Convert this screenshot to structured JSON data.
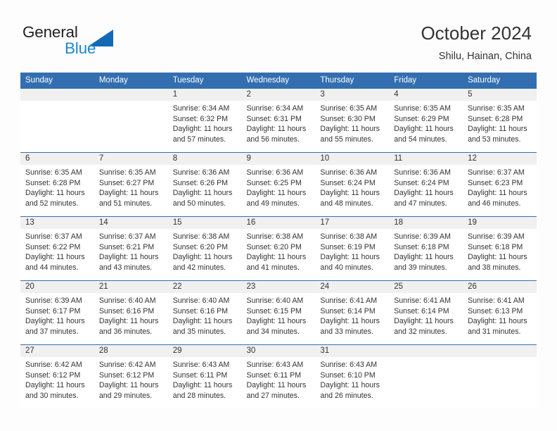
{
  "brand": {
    "name_part1": "General",
    "name_part2": "Blue",
    "triangle_color": "#1469b7",
    "blue_text_color": "#1b87d4"
  },
  "header": {
    "title": "October 2024",
    "location": "Shilu, Hainan, China"
  },
  "theme": {
    "header_row_bg": "#336fb0",
    "daynum_band_bg": "#f0f0f0",
    "row_separator": "#336fb0",
    "text_color": "#333333"
  },
  "weekdays": [
    "Sunday",
    "Monday",
    "Tuesday",
    "Wednesday",
    "Thursday",
    "Friday",
    "Saturday"
  ],
  "labels": {
    "sunrise_prefix": "Sunrise: ",
    "sunset_prefix": "Sunset: ",
    "daylight_prefix": "Daylight: "
  },
  "weeks": [
    [
      {
        "empty": true
      },
      {
        "empty": true
      },
      {
        "day": "1",
        "sunrise": "Sunrise: 6:34 AM",
        "sunset": "Sunset: 6:32 PM",
        "daylight_l1": "Daylight: 11 hours",
        "daylight_l2": "and 57 minutes."
      },
      {
        "day": "2",
        "sunrise": "Sunrise: 6:34 AM",
        "sunset": "Sunset: 6:31 PM",
        "daylight_l1": "Daylight: 11 hours",
        "daylight_l2": "and 56 minutes."
      },
      {
        "day": "3",
        "sunrise": "Sunrise: 6:35 AM",
        "sunset": "Sunset: 6:30 PM",
        "daylight_l1": "Daylight: 11 hours",
        "daylight_l2": "and 55 minutes."
      },
      {
        "day": "4",
        "sunrise": "Sunrise: 6:35 AM",
        "sunset": "Sunset: 6:29 PM",
        "daylight_l1": "Daylight: 11 hours",
        "daylight_l2": "and 54 minutes."
      },
      {
        "day": "5",
        "sunrise": "Sunrise: 6:35 AM",
        "sunset": "Sunset: 6:28 PM",
        "daylight_l1": "Daylight: 11 hours",
        "daylight_l2": "and 53 minutes."
      }
    ],
    [
      {
        "day": "6",
        "sunrise": "Sunrise: 6:35 AM",
        "sunset": "Sunset: 6:28 PM",
        "daylight_l1": "Daylight: 11 hours",
        "daylight_l2": "and 52 minutes."
      },
      {
        "day": "7",
        "sunrise": "Sunrise: 6:35 AM",
        "sunset": "Sunset: 6:27 PM",
        "daylight_l1": "Daylight: 11 hours",
        "daylight_l2": "and 51 minutes."
      },
      {
        "day": "8",
        "sunrise": "Sunrise: 6:36 AM",
        "sunset": "Sunset: 6:26 PM",
        "daylight_l1": "Daylight: 11 hours",
        "daylight_l2": "and 50 minutes."
      },
      {
        "day": "9",
        "sunrise": "Sunrise: 6:36 AM",
        "sunset": "Sunset: 6:25 PM",
        "daylight_l1": "Daylight: 11 hours",
        "daylight_l2": "and 49 minutes."
      },
      {
        "day": "10",
        "sunrise": "Sunrise: 6:36 AM",
        "sunset": "Sunset: 6:24 PM",
        "daylight_l1": "Daylight: 11 hours",
        "daylight_l2": "and 48 minutes."
      },
      {
        "day": "11",
        "sunrise": "Sunrise: 6:36 AM",
        "sunset": "Sunset: 6:24 PM",
        "daylight_l1": "Daylight: 11 hours",
        "daylight_l2": "and 47 minutes."
      },
      {
        "day": "12",
        "sunrise": "Sunrise: 6:37 AM",
        "sunset": "Sunset: 6:23 PM",
        "daylight_l1": "Daylight: 11 hours",
        "daylight_l2": "and 46 minutes."
      }
    ],
    [
      {
        "day": "13",
        "sunrise": "Sunrise: 6:37 AM",
        "sunset": "Sunset: 6:22 PM",
        "daylight_l1": "Daylight: 11 hours",
        "daylight_l2": "and 44 minutes."
      },
      {
        "day": "14",
        "sunrise": "Sunrise: 6:37 AM",
        "sunset": "Sunset: 6:21 PM",
        "daylight_l1": "Daylight: 11 hours",
        "daylight_l2": "and 43 minutes."
      },
      {
        "day": "15",
        "sunrise": "Sunrise: 6:38 AM",
        "sunset": "Sunset: 6:20 PM",
        "daylight_l1": "Daylight: 11 hours",
        "daylight_l2": "and 42 minutes."
      },
      {
        "day": "16",
        "sunrise": "Sunrise: 6:38 AM",
        "sunset": "Sunset: 6:20 PM",
        "daylight_l1": "Daylight: 11 hours",
        "daylight_l2": "and 41 minutes."
      },
      {
        "day": "17",
        "sunrise": "Sunrise: 6:38 AM",
        "sunset": "Sunset: 6:19 PM",
        "daylight_l1": "Daylight: 11 hours",
        "daylight_l2": "and 40 minutes."
      },
      {
        "day": "18",
        "sunrise": "Sunrise: 6:39 AM",
        "sunset": "Sunset: 6:18 PM",
        "daylight_l1": "Daylight: 11 hours",
        "daylight_l2": "and 39 minutes."
      },
      {
        "day": "19",
        "sunrise": "Sunrise: 6:39 AM",
        "sunset": "Sunset: 6:18 PM",
        "daylight_l1": "Daylight: 11 hours",
        "daylight_l2": "and 38 minutes."
      }
    ],
    [
      {
        "day": "20",
        "sunrise": "Sunrise: 6:39 AM",
        "sunset": "Sunset: 6:17 PM",
        "daylight_l1": "Daylight: 11 hours",
        "daylight_l2": "and 37 minutes."
      },
      {
        "day": "21",
        "sunrise": "Sunrise: 6:40 AM",
        "sunset": "Sunset: 6:16 PM",
        "daylight_l1": "Daylight: 11 hours",
        "daylight_l2": "and 36 minutes."
      },
      {
        "day": "22",
        "sunrise": "Sunrise: 6:40 AM",
        "sunset": "Sunset: 6:16 PM",
        "daylight_l1": "Daylight: 11 hours",
        "daylight_l2": "and 35 minutes."
      },
      {
        "day": "23",
        "sunrise": "Sunrise: 6:40 AM",
        "sunset": "Sunset: 6:15 PM",
        "daylight_l1": "Daylight: 11 hours",
        "daylight_l2": "and 34 minutes."
      },
      {
        "day": "24",
        "sunrise": "Sunrise: 6:41 AM",
        "sunset": "Sunset: 6:14 PM",
        "daylight_l1": "Daylight: 11 hours",
        "daylight_l2": "and 33 minutes."
      },
      {
        "day": "25",
        "sunrise": "Sunrise: 6:41 AM",
        "sunset": "Sunset: 6:14 PM",
        "daylight_l1": "Daylight: 11 hours",
        "daylight_l2": "and 32 minutes."
      },
      {
        "day": "26",
        "sunrise": "Sunrise: 6:41 AM",
        "sunset": "Sunset: 6:13 PM",
        "daylight_l1": "Daylight: 11 hours",
        "daylight_l2": "and 31 minutes."
      }
    ],
    [
      {
        "day": "27",
        "sunrise": "Sunrise: 6:42 AM",
        "sunset": "Sunset: 6:12 PM",
        "daylight_l1": "Daylight: 11 hours",
        "daylight_l2": "and 30 minutes."
      },
      {
        "day": "28",
        "sunrise": "Sunrise: 6:42 AM",
        "sunset": "Sunset: 6:12 PM",
        "daylight_l1": "Daylight: 11 hours",
        "daylight_l2": "and 29 minutes."
      },
      {
        "day": "29",
        "sunrise": "Sunrise: 6:43 AM",
        "sunset": "Sunset: 6:11 PM",
        "daylight_l1": "Daylight: 11 hours",
        "daylight_l2": "and 28 minutes."
      },
      {
        "day": "30",
        "sunrise": "Sunrise: 6:43 AM",
        "sunset": "Sunset: 6:11 PM",
        "daylight_l1": "Daylight: 11 hours",
        "daylight_l2": "and 27 minutes."
      },
      {
        "day": "31",
        "sunrise": "Sunrise: 6:43 AM",
        "sunset": "Sunset: 6:10 PM",
        "daylight_l1": "Daylight: 11 hours",
        "daylight_l2": "and 26 minutes."
      },
      {
        "empty": true
      },
      {
        "empty": true
      }
    ]
  ]
}
